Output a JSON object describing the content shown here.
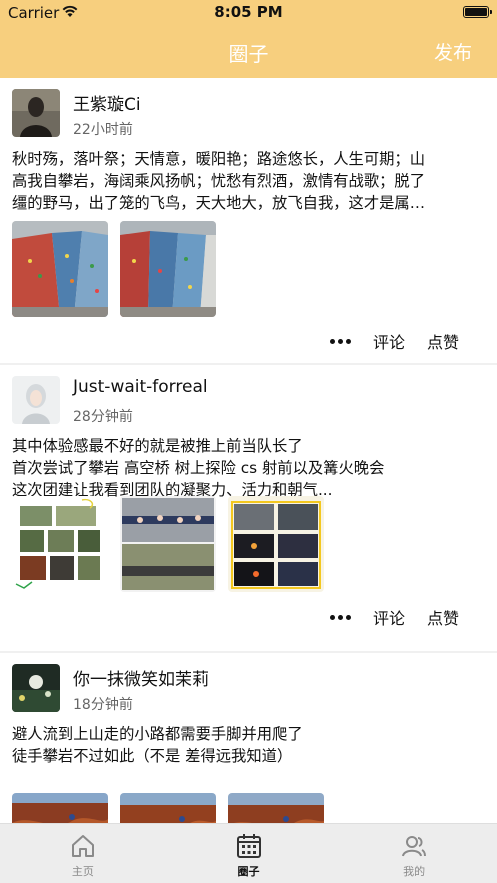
{
  "status": {
    "carrier": "Carrier",
    "time": "8:05 PM"
  },
  "nav": {
    "title": "圈子",
    "publish": "发布"
  },
  "posts": [
    {
      "username": "王紫璇Ci",
      "time": "22小时前",
      "lines": [
        "秋时殇，落叶祭；天情意，暖阳艳；路途悠长，人生可期；山",
        "高我自攀岩，海阔乘风扬帆；忧愁有烈酒，激情有战歌；脱了",
        "缰的野马，出了笼的飞鸟，天大地大，放飞自我，这才是属…"
      ],
      "more_icon": "more-dots-icon",
      "comment": "评论",
      "like": "点赞"
    },
    {
      "username": "Just-wait-forreal",
      "time": "28分钟前",
      "lines": [
        "其中体验感最不好的就是被推上前当队长了",
        "首次尝试了攀岩 高空桥 树上探险 cs 射前以及篝火晚会",
        "这次团建让我看到团队的凝聚力、活力和朝气..."
      ],
      "more_icon": "more-dots-icon",
      "comment": "评论",
      "like": "点赞"
    },
    {
      "username": "你一抹微笑如茉莉",
      "time": "18分钟前",
      "lines": [
        "避人流到上山走的小路都需要手脚并用爬了",
        "徒手攀岩不过如此（不是 差得远我知道）"
      ]
    }
  ],
  "tabs": [
    {
      "label": "主页",
      "icon": "home-icon"
    },
    {
      "label": "圈子",
      "icon": "calendar-icon"
    },
    {
      "label": "我的",
      "icon": "users-icon"
    }
  ],
  "colors": {
    "accent": "#f7cf7e",
    "nav_text": "#ffffff"
  }
}
